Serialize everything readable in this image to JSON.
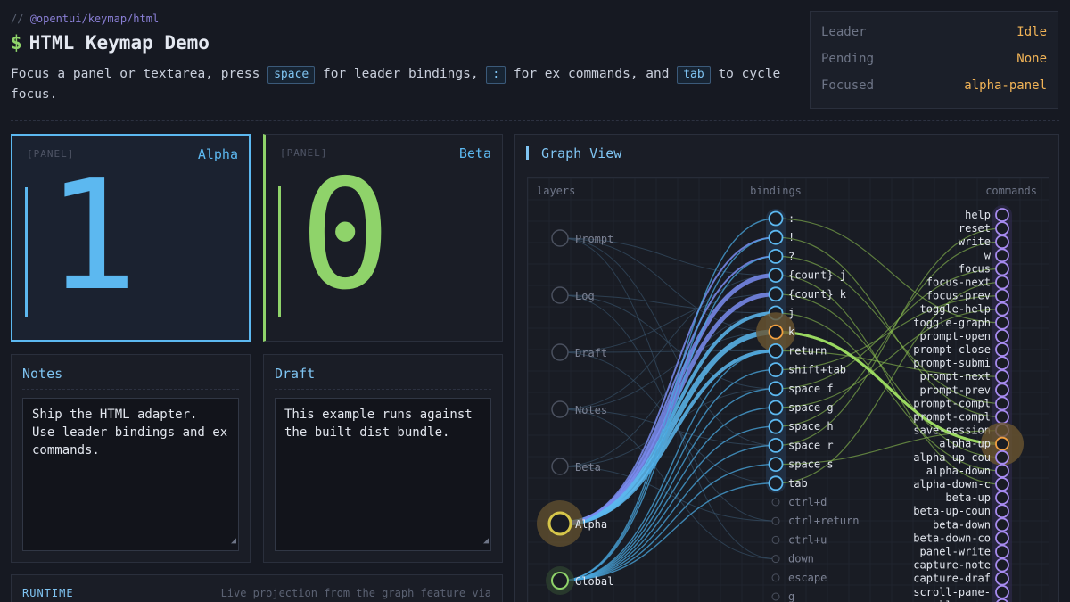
{
  "header": {
    "package": "@opentui/keymap/html",
    "comment_prefix": "//",
    "prompt_symbol": "$",
    "title": "HTML Keymap Demo",
    "desc_1": "Focus a panel or textarea, press",
    "kbd_space": "space",
    "desc_2": "for leader bindings,",
    "kbd_colon": ":",
    "desc_3": "for ex commands, and",
    "kbd_tab": "tab",
    "desc_4": "to cycle focus."
  },
  "status": {
    "leader_label": "Leader",
    "leader_value": "Idle",
    "pending_label": "Pending",
    "pending_value": "None",
    "focused_label": "Focused",
    "focused_value": "alpha-panel"
  },
  "panels": {
    "alpha": {
      "tag": "[PANEL]",
      "name": "Alpha",
      "count": "1",
      "color": "#5cb8f0"
    },
    "beta": {
      "tag": "[PANEL]",
      "name": "Beta",
      "count": "0",
      "color": "#8fd36a"
    }
  },
  "notes": {
    "title": "Notes",
    "text": "Ship the HTML adapter.\nUse leader bindings and ex\ncommands."
  },
  "draft": {
    "title": "Draft",
    "text": "This example runs against\nthe built dist bundle."
  },
  "runtime": {
    "label": "RUNTIME",
    "info": "Live projection from the graph feature via"
  },
  "graph": {
    "title": "Graph View",
    "col_layers": "layers",
    "col_bindings": "bindings",
    "col_commands": "commands",
    "layers": [
      "Prompt",
      "Log",
      "Draft",
      "Notes",
      "Beta",
      "Alpha",
      "Global"
    ],
    "bindings": [
      ":",
      "!",
      "?",
      "{count} j",
      "{count} k",
      "j",
      "k",
      "return",
      "shift+tab",
      "space f",
      "space g",
      "space h",
      "space r",
      "space s",
      "tab",
      "ctrl+d",
      "ctrl+return",
      "ctrl+u",
      "down",
      "escape",
      "g"
    ],
    "commands": [
      "help",
      "reset",
      "write",
      "w",
      "focus",
      "focus-next",
      "focus-prev",
      "toggle-help",
      "toggle-graph",
      "prompt-open",
      "prompt-close",
      "prompt-submi",
      "prompt-next",
      "prompt-prev",
      "prompt-compl",
      "prompt-compl",
      "save-session",
      "alpha-up",
      "alpha-up-cou",
      "alpha-down",
      "alpha-down-c",
      "beta-up",
      "beta-up-coun",
      "beta-down",
      "beta-down-co",
      "panel-write",
      "capture-note",
      "capture-draf",
      "scroll-pane-",
      "scroll-pane-"
    ],
    "active_layers": [
      "Alpha",
      "Global"
    ],
    "highlight_binding": "k",
    "highlight_command": "alpha-up",
    "colors": {
      "layer_alpha": "#d6c64a",
      "layer_global": "#8fd36a",
      "binding": "#5cb8f0",
      "command": "#a78bf0",
      "highlight": "#f2a040"
    }
  }
}
